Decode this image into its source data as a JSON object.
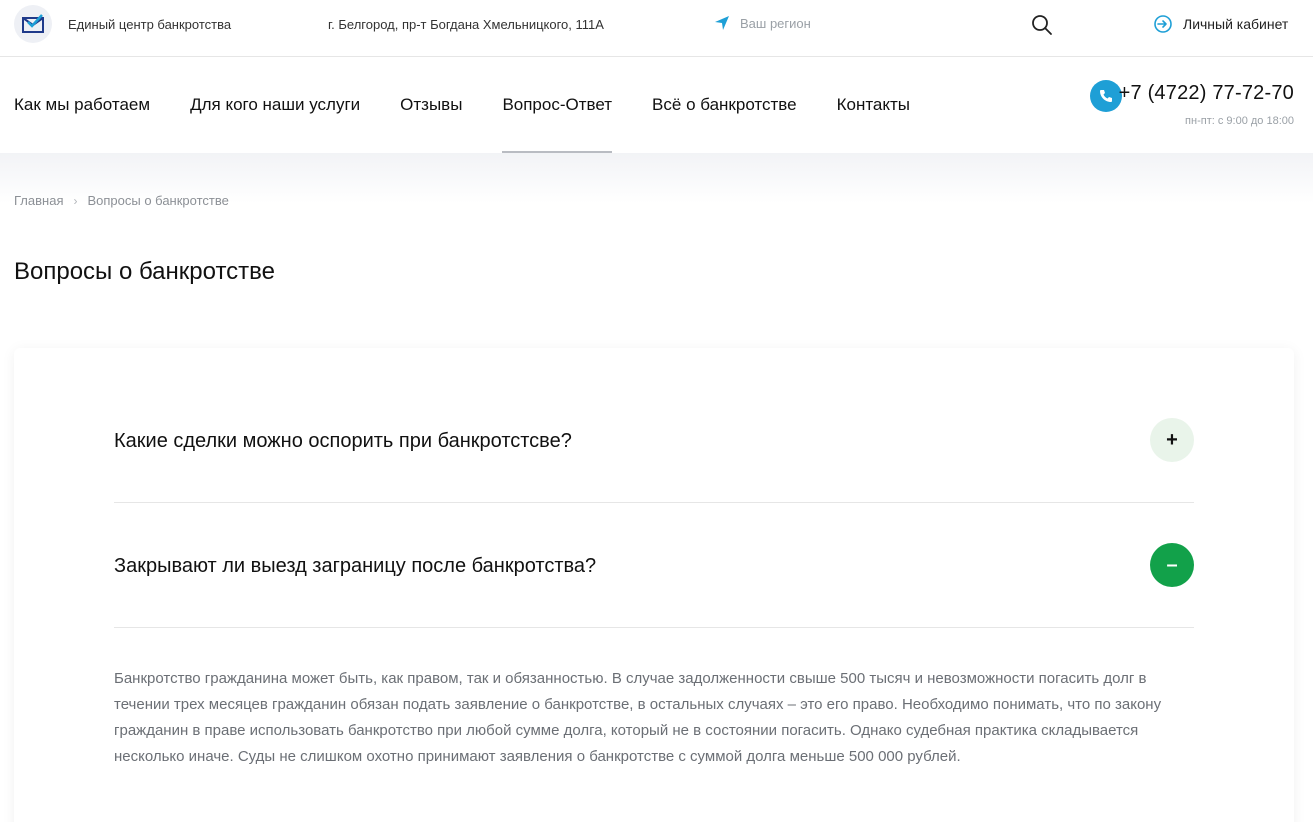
{
  "header": {
    "logo_icon": "checkmark-envelope-icon",
    "brand": "Единый центр банкротства",
    "address": "г. Белгород, пр-т Богдана Хмельницкого, 111А",
    "region": "Ваш регион",
    "cabinet": "Личный кабинет"
  },
  "nav": {
    "items": [
      "Как мы работаем",
      "Для кого наши услуги",
      "Отзывы",
      "Вопрос-Ответ",
      "Всё о банкротстве",
      "Контакты"
    ],
    "active": "Вопрос-Ответ"
  },
  "contact": {
    "phone": "+7 (4722) 77-72-70",
    "hours": "пн-пт: с 9:00 до 18:00"
  },
  "breadcrumb": {
    "home": "Главная",
    "current": "Вопросы о банкротстве"
  },
  "page": {
    "title": "Вопросы о банкротстве"
  },
  "faq": {
    "items": [
      {
        "question": "Какие сделки можно оспорить при банкротстсве?",
        "toggle": "+",
        "expanded": false
      },
      {
        "question": "Закрывают ли выезд заграницу после банкротства?",
        "toggle": "–",
        "expanded": true
      }
    ],
    "answer": "Банкротство гражданина может быть, как правом, так и обязанностью. В случае задолженности свыше 500 тысяч и невозможности погасить долг в течении трех месяцев гражданин обязан подать заявление о банкротстве, в остальных случаях – это его право. Необходимо понимать, что по закону гражданин в праве использовать банкротство при любой сумме долга, который не в состоянии погасить. Однако судебная практика складывается несколько иначе. Суды не слишком охотно принимают заявления о банкротстве с суммой долга меньше 500 000 рублей."
  },
  "colors": {
    "accent_green": "#12a14a",
    "light_green": "#e9f4ea",
    "phone_blue": "#1e9fd6"
  }
}
